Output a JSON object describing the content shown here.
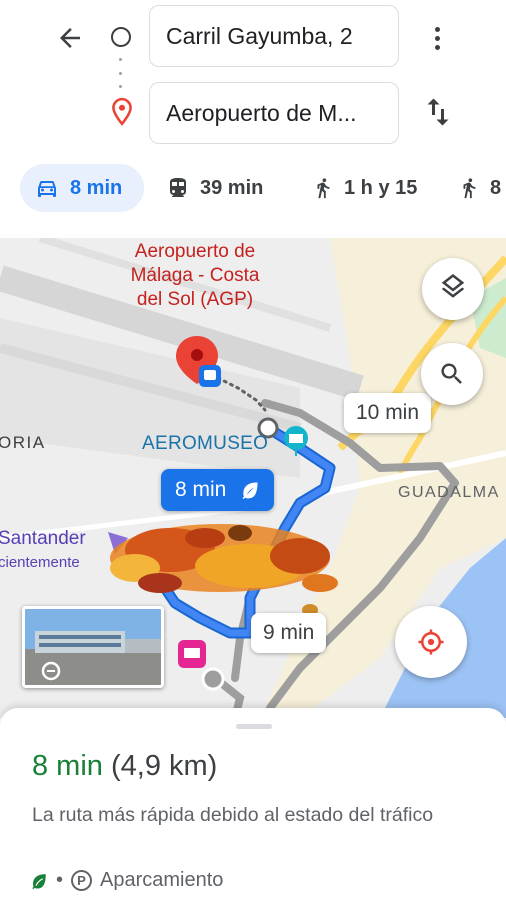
{
  "search": {
    "origin": "Carril Gayumba, 2",
    "destination": "Aeropuerto de M..."
  },
  "modes": [
    {
      "name": "car",
      "label": "8 min",
      "active": true
    },
    {
      "name": "transit",
      "label": "39 min"
    },
    {
      "name": "walk",
      "label": "1 h y 15"
    },
    {
      "name": "bike",
      "label": "8"
    }
  ],
  "map": {
    "labels": {
      "airport_line1": "Aeropuerto de",
      "airport_line2": "Málaga - Costa",
      "airport_line3": "del Sol (AGP)",
      "aeromuseo": "AEROMUSEO",
      "guadalma": "GUADALMA",
      "oria": "ORIA",
      "santander": "Santander",
      "santander_sub": "cientemente"
    },
    "route_chips": {
      "primary": "8 min",
      "alt_1": "10 min",
      "alt_2": "9 min"
    },
    "colors": {
      "route_primary": "#4285f4",
      "route_alt": "#9e9e9e",
      "water": "#9cc3f5",
      "highway": "#fdd663",
      "pin": "#ea4335"
    }
  },
  "sheet": {
    "duration": "8 min",
    "distance": "(4,9 km)",
    "description": "La ruta más rápida debido al estado del tráfico",
    "separator": "•",
    "parking_icon_letter": "P",
    "parking_label": "Aparcamiento"
  },
  "icons": [
    "back-arrow-icon",
    "origin-circle-icon",
    "destination-pin-icon",
    "more-vert-icon",
    "swap-icon",
    "car-icon",
    "transit-icon",
    "walk-icon",
    "bike-icon",
    "layers-icon",
    "search-icon",
    "locate-icon",
    "leaf-icon",
    "parking-icon",
    "hotel-icon",
    "autumn-leaves-overlay"
  ]
}
